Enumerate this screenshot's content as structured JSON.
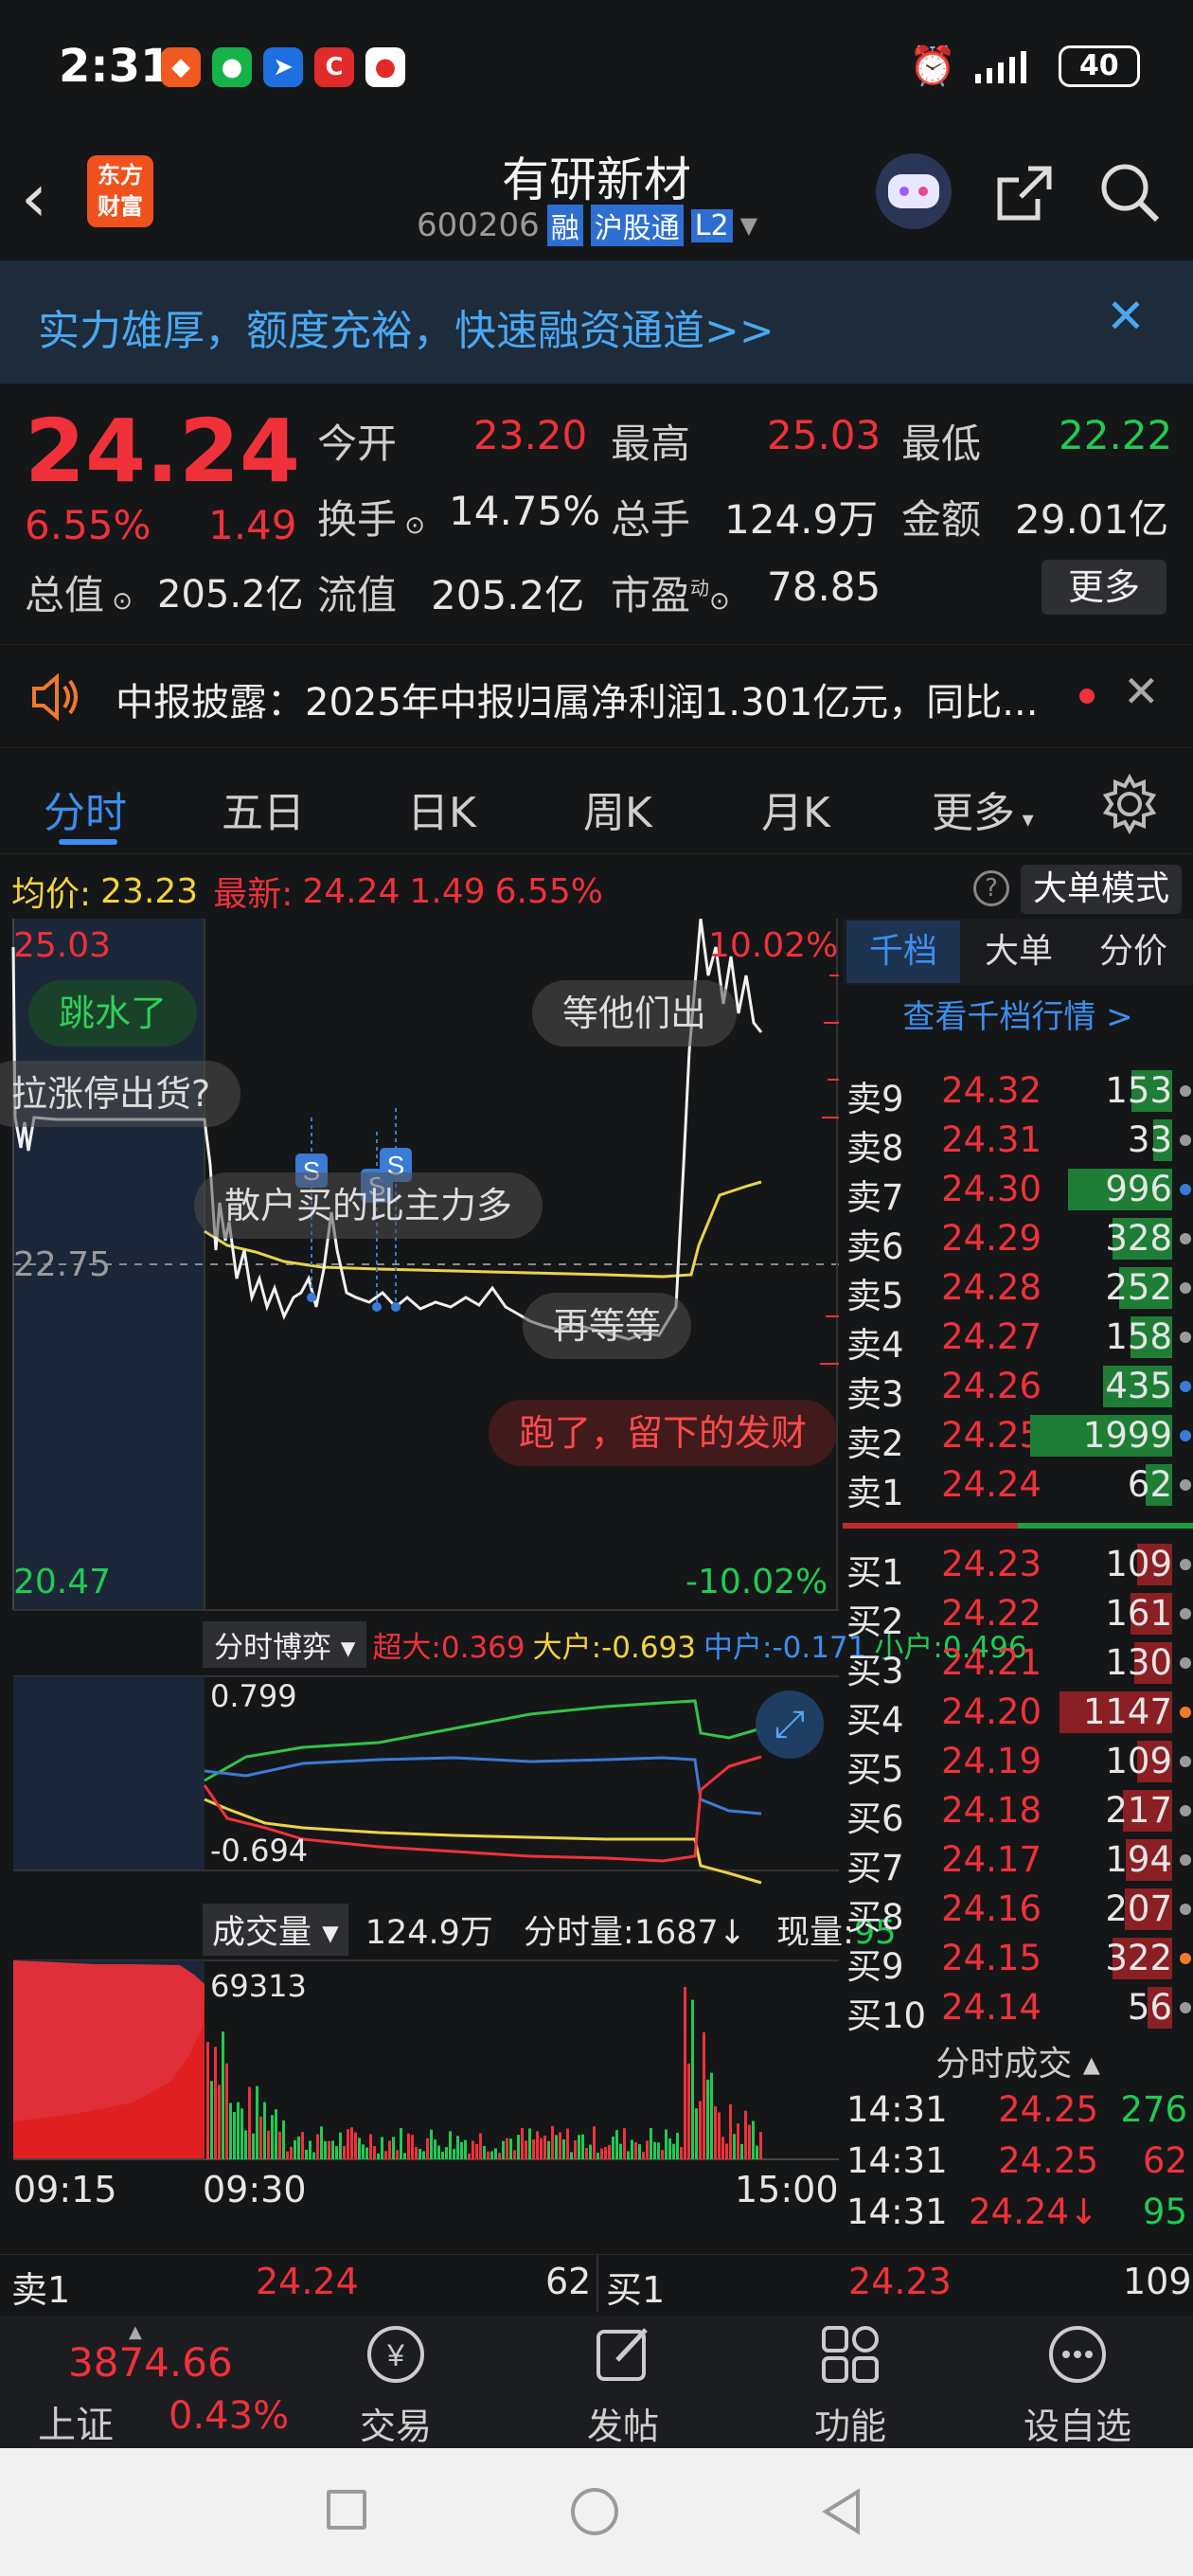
{
  "status": {
    "time": "2:31",
    "battery": "40",
    "network": "4G"
  },
  "nav": {
    "logo_line1": "东方",
    "logo_line2": "财富",
    "title": "有研新材",
    "code": "600206",
    "tag_margin": "融",
    "tag_connect": "沪股通",
    "tag_level": "L2"
  },
  "banner": {
    "text": "实力雄厚，额度充裕，快速融资通道>>"
  },
  "quote": {
    "price": "24.24",
    "change_pct": "6.55%",
    "change": "1.49",
    "open_label": "今开",
    "open": "23.20",
    "high_label": "最高",
    "high": "25.03",
    "low_label": "最低",
    "low": "22.22",
    "turnover_label": "换手",
    "turnover": "14.75%",
    "volume_label": "总手",
    "volume": "124.9万",
    "amount_label": "金额",
    "amount": "29.01亿",
    "mktcap_label": "总值",
    "mktcap": "205.2亿",
    "float_label": "流值",
    "float_cap": "205.2亿",
    "pe_label": "市盈",
    "pe_sup": "动",
    "pe": "78.85",
    "more_label": "更多"
  },
  "news": {
    "text": "中报披露：2025年中报归属净利润1.301亿元，同比..."
  },
  "tabs": [
    "分时",
    "五日",
    "日K",
    "周K",
    "月K",
    "更多"
  ],
  "info": {
    "avg_label": "均价:",
    "avg": "23.23",
    "last_label": "最新:",
    "last": "24.24",
    "chg": "1.49",
    "pct": "6.55%",
    "mode_label": "大单模式"
  },
  "chart": {
    "y_high": "25.03",
    "y_mid": "22.75",
    "y_low": "20.47",
    "pct_high": "10.02%",
    "pct_low": "-10.02%",
    "bubbles": [
      "跳水了",
      "等他们出",
      "拉涨停出货?",
      "散户买的比主力多",
      "再等等",
      "跑了，留下的发财"
    ],
    "flow_label": "分时博弈",
    "flow_super": "超大:0.369",
    "flow_big": "大户:-0.693",
    "flow_mid": "中户:-0.171",
    "flow_small": "小户:0.496",
    "flow_max": "0.799",
    "flow_min": "-0.694",
    "vol_label": "成交量",
    "vol_total": "124.9万",
    "vol_minute": "分时量:1687",
    "vol_now_label": "现量:",
    "vol_now": "95",
    "vol_max": "69313",
    "t_start": "09:15",
    "t_open": "09:30",
    "t_end": "15:00"
  },
  "side": {
    "tabs": [
      "千档",
      "大单",
      "分价"
    ],
    "link": "查看千档行情 >",
    "asks": [
      {
        "label": "卖9",
        "price": "24.32",
        "vol": "153",
        "color": "#9a9a9a"
      },
      {
        "label": "卖8",
        "price": "24.31",
        "vol": "33",
        "color": "#9a9a9a"
      },
      {
        "label": "卖7",
        "price": "24.30",
        "vol": "996",
        "color": "#3a7bd5"
      },
      {
        "label": "卖6",
        "price": "24.29",
        "vol": "328",
        "color": "#9a9a9a"
      },
      {
        "label": "卖5",
        "price": "24.28",
        "vol": "252",
        "color": "#9a9a9a"
      },
      {
        "label": "卖4",
        "price": "24.27",
        "vol": "158",
        "color": "#9a9a9a"
      },
      {
        "label": "卖3",
        "price": "24.26",
        "vol": "435",
        "color": "#3a7bd5"
      },
      {
        "label": "卖2",
        "price": "24.25",
        "vol": "1999",
        "color": "#3a7bd5"
      },
      {
        "label": "卖1",
        "price": "24.24",
        "vol": "62",
        "color": "#9a9a9a"
      }
    ],
    "bids": [
      {
        "label": "买1",
        "price": "24.23",
        "vol": "109",
        "color": "#9a9a9a"
      },
      {
        "label": "买2",
        "price": "24.22",
        "vol": "161",
        "color": "#9a9a9a"
      },
      {
        "label": "买3",
        "price": "24.21",
        "vol": "130",
        "color": "#9a9a9a"
      },
      {
        "label": "买4",
        "price": "24.20",
        "vol": "1147",
        "color": "#f07a2a"
      },
      {
        "label": "买5",
        "price": "24.19",
        "vol": "109",
        "color": "#9a9a9a"
      },
      {
        "label": "买6",
        "price": "24.18",
        "vol": "217",
        "color": "#9a9a9a"
      },
      {
        "label": "买7",
        "price": "24.17",
        "vol": "194",
        "color": "#9a9a9a"
      },
      {
        "label": "买8",
        "price": "24.16",
        "vol": "207",
        "color": "#9a9a9a"
      },
      {
        "label": "买9",
        "price": "24.15",
        "vol": "322",
        "color": "#f07a2a"
      },
      {
        "label": "买10",
        "price": "24.14",
        "vol": "56",
        "color": "#9a9a9a"
      }
    ],
    "trades_label": "分时成交",
    "trades": [
      {
        "time": "14:31",
        "price": "24.25",
        "vol": "276"
      },
      {
        "time": "14:31",
        "price": "24.25",
        "vol": "62"
      },
      {
        "time": "14:31",
        "price": "24.24",
        "vol": "95"
      }
    ]
  },
  "bottom": {
    "sell_label": "卖1",
    "sell_price": "24.24",
    "sell_vol": "62",
    "buy_label": "买1",
    "buy_price": "24.23",
    "buy_vol": "109"
  },
  "tabbar": {
    "index_value": "3874.66",
    "index_name": "上证",
    "index_pct": "0.43%",
    "items": [
      "交易",
      "发帖",
      "功能",
      "设自选"
    ]
  }
}
